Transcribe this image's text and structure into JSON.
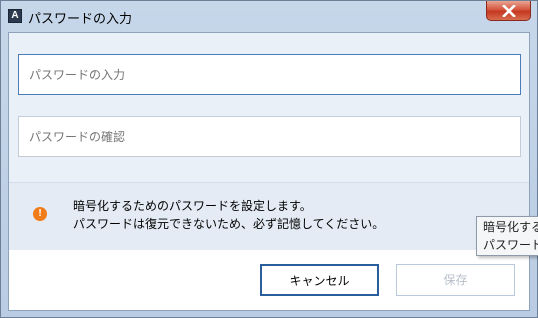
{
  "window": {
    "title": "パスワードの入力",
    "app_icon_letter": "A"
  },
  "form": {
    "password_placeholder": "パスワードの入力",
    "confirm_placeholder": "パスワードの確認"
  },
  "notice": {
    "icon": "warning-icon",
    "line1": "暗号化するためのパスワードを設定します。",
    "line2": "パスワードは復元できないため、必ず記憶してください。"
  },
  "buttons": {
    "cancel_label": "キャンセル",
    "save_label": "保存"
  },
  "tooltip": {
    "line1": "暗号化する",
    "line2": "パスワード"
  },
  "colors": {
    "accent": "#2a5f9e",
    "warning": "#f07c19"
  }
}
